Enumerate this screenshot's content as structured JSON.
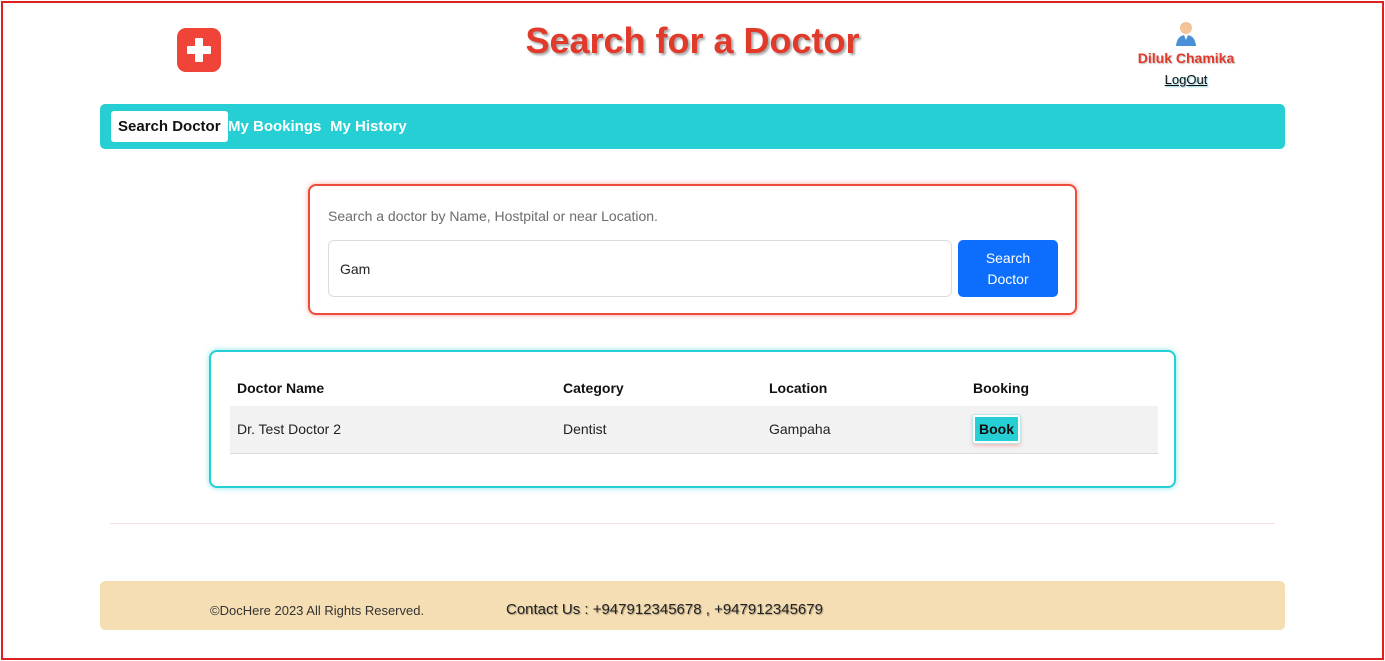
{
  "header": {
    "logo_icon": "medical-cross-icon",
    "title": "Search for a Doctor",
    "user": {
      "avatar_icon": "user-avatar-icon",
      "name": "Diluk Chamika",
      "logout_label": "LogOut"
    }
  },
  "nav": {
    "tabs": [
      {
        "label": "Search Doctor",
        "active": true
      },
      {
        "label": "My Bookings",
        "active": false
      },
      {
        "label": "My History",
        "active": false
      }
    ]
  },
  "search": {
    "hint": "Search a doctor by Name, Hostpital or near Location.",
    "value": "Gam",
    "button_label": "Search Doctor"
  },
  "results": {
    "headers": [
      "Doctor Name",
      "Category",
      "Location",
      "Booking"
    ],
    "rows": [
      {
        "name": "Dr. Test Doctor 2",
        "category": "Dentist",
        "location": "Gampaha",
        "action_label": "Book"
      }
    ]
  },
  "footer": {
    "copyright": "©DocHere 2023 All Rights Reserved.",
    "contact": "Contact Us : +947912345678 , +947912345679"
  },
  "colors": {
    "accent_teal": "#26cfd3",
    "title_red": "#e23a2a",
    "primary_blue": "#0d6efd",
    "footer_bg": "#f5deb3"
  }
}
